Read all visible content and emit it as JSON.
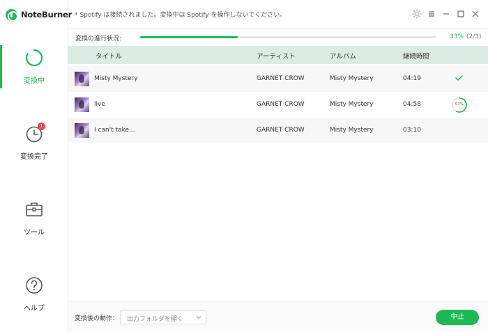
{
  "app": {
    "name": "NoteBurner"
  },
  "notice": "* Spotify は接続されました。変換中は Spotify を操作しないでください。",
  "sidebar": {
    "items": [
      {
        "label": "変換中",
        "icon": "converting-icon",
        "active": true
      },
      {
        "label": "変換完了",
        "icon": "history-clock-icon",
        "badge": "1"
      },
      {
        "label": "ツール",
        "icon": "toolbox-icon"
      },
      {
        "label": "ヘルプ",
        "icon": "help-icon"
      }
    ]
  },
  "progress": {
    "label": "変換の進行状況:",
    "percent_text": "33%",
    "count_text": "(2/3)",
    "fraction": 0.33
  },
  "table": {
    "headers": {
      "title": "タイトル",
      "artist": "アーティスト",
      "album": "アルバム",
      "duration": "継続時間"
    },
    "rows": [
      {
        "title": "Misty Mystery",
        "artist": "GARNET CROW",
        "album": "Misty Mystery",
        "duration": "04:19",
        "status": "done"
      },
      {
        "title": "live",
        "artist": "GARNET CROW",
        "album": "Misty Mystery",
        "duration": "04:58",
        "status": "converting",
        "progress_text": "57%",
        "progress": 0.57
      },
      {
        "title": "I can't take...",
        "artist": "GARNET CROW",
        "album": "Misty Mystery",
        "duration": "03:10",
        "status": "waiting"
      }
    ]
  },
  "footer": {
    "after_label": "変換後の動作：",
    "after_value": "出力フォルダを開く",
    "stop_label": "中止"
  },
  "colors": {
    "accent": "#1db954",
    "header_bg": "#dbebe2",
    "badge": "#f04848"
  }
}
